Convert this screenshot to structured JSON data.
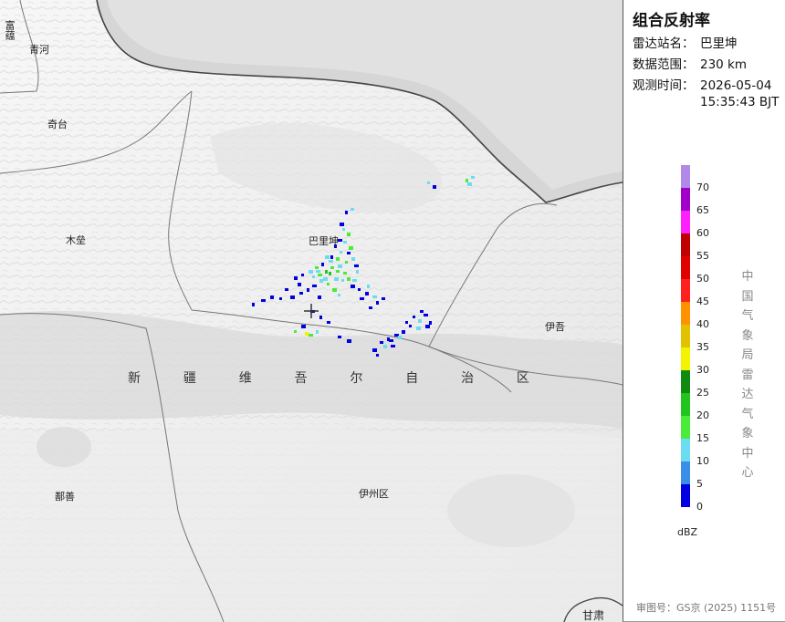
{
  "header": {
    "title": "组合反射率",
    "station_key": "雷达站名：",
    "station_value": "巴里坤",
    "range_key": "数据范围：",
    "range_value": "230 km",
    "time_key": "观测时间：",
    "time_date": "2026-05-04",
    "time_clock": "15:35:43 BJT"
  },
  "map": {
    "places": {
      "fuyun": "富蕴",
      "qinghe": "青河",
      "qitai": "奇台",
      "mulei": "木垒",
      "balikun": "巴里坤",
      "yiwu": "伊吾",
      "shanshan": "鄯善",
      "yizhou": "伊州区",
      "gansu": "甘肃"
    },
    "region_chars": [
      "新",
      "疆",
      "维",
      "吾",
      "尔",
      "自",
      "治",
      "区"
    ],
    "colors": {
      "land": "#f1f1f1",
      "foreign": "#d8d8d8",
      "border": "#555555",
      "marker": "#333333"
    },
    "echo_points": [
      [
        378,
        231,
        "b"
      ],
      [
        384,
        228,
        "c"
      ],
      [
        372,
        244,
        "b"
      ],
      [
        375,
        250,
        "c"
      ],
      [
        380,
        255,
        "g"
      ],
      [
        370,
        262,
        "b"
      ],
      [
        366,
        268,
        "b"
      ],
      [
        376,
        264,
        "c"
      ],
      [
        382,
        270,
        "g"
      ],
      [
        372,
        275,
        "c"
      ],
      [
        368,
        282,
        "g"
      ],
      [
        360,
        285,
        "c"
      ],
      [
        352,
        288,
        "b"
      ],
      [
        345,
        292,
        "g"
      ],
      [
        338,
        296,
        "c"
      ],
      [
        330,
        300,
        "b"
      ],
      [
        322,
        303,
        "b"
      ],
      [
        348,
        300,
        "g"
      ],
      [
        356,
        296,
        "G"
      ],
      [
        362,
        292,
        "g"
      ],
      [
        370,
        290,
        "c"
      ],
      [
        378,
        286,
        "g"
      ],
      [
        385,
        282,
        "c"
      ],
      [
        388,
        290,
        "b"
      ],
      [
        390,
        296,
        "c"
      ],
      [
        376,
        298,
        "g"
      ],
      [
        366,
        304,
        "c"
      ],
      [
        358,
        310,
        "g"
      ],
      [
        350,
        306,
        "c"
      ],
      [
        342,
        312,
        "b"
      ],
      [
        336,
        316,
        "b"
      ],
      [
        328,
        320,
        "b"
      ],
      [
        318,
        324,
        "b"
      ],
      [
        306,
        326,
        "b"
      ],
      [
        296,
        324,
        "b"
      ],
      [
        286,
        328,
        "b"
      ],
      [
        276,
        332,
        "b"
      ],
      [
        312,
        316,
        "b"
      ],
      [
        384,
        312,
        "b"
      ],
      [
        392,
        316,
        "b"
      ],
      [
        400,
        320,
        "b"
      ],
      [
        408,
        324,
        "c"
      ],
      [
        412,
        330,
        "b"
      ],
      [
        404,
        336,
        "b"
      ],
      [
        364,
        316,
        "g"
      ],
      [
        370,
        322,
        "c"
      ],
      [
        348,
        324,
        "b"
      ],
      [
        340,
        340,
        "b"
      ],
      [
        350,
        346,
        "b"
      ],
      [
        358,
        352,
        "b"
      ],
      [
        330,
        356,
        "b"
      ],
      [
        322,
        362,
        "g"
      ],
      [
        334,
        364,
        "y"
      ],
      [
        338,
        366,
        "g"
      ],
      [
        346,
        362,
        "c"
      ],
      [
        370,
        368,
        "b"
      ],
      [
        380,
        372,
        "b"
      ],
      [
        452,
        346,
        "b"
      ],
      [
        458,
        350,
        "c"
      ],
      [
        464,
        344,
        "b"
      ],
      [
        470,
        352,
        "b"
      ],
      [
        460,
        340,
        "b"
      ],
      [
        466,
        356,
        "b"
      ],
      [
        448,
        356,
        "b"
      ],
      [
        440,
        362,
        "b"
      ],
      [
        432,
        366,
        "b"
      ],
      [
        424,
        370,
        "b"
      ],
      [
        416,
        374,
        "b"
      ],
      [
        408,
        382,
        "b"
      ],
      [
        412,
        388,
        "b"
      ],
      [
        420,
        378,
        "c"
      ],
      [
        426,
        372,
        "b"
      ],
      [
        510,
        196,
        "g"
      ],
      [
        516,
        193,
        "c"
      ],
      [
        512,
        200,
        "c"
      ],
      [
        468,
        199,
        "c"
      ],
      [
        474,
        203,
        "b"
      ],
      [
        346,
        296,
        "c"
      ],
      [
        360,
        298,
        "G"
      ],
      [
        368,
        296,
        "g"
      ],
      [
        354,
        304,
        "c"
      ],
      [
        374,
        306,
        "c"
      ],
      [
        380,
        304,
        "g"
      ],
      [
        386,
        306,
        "c"
      ],
      [
        362,
        280,
        "b"
      ],
      [
        380,
        276,
        "b"
      ],
      [
        356,
        280,
        "c"
      ],
      [
        342,
        302,
        "c"
      ],
      [
        326,
        310,
        "b"
      ],
      [
        394,
        326,
        "b"
      ],
      [
        402,
        312,
        "c"
      ],
      [
        418,
        326,
        "b"
      ],
      [
        456,
        358,
        "c"
      ],
      [
        444,
        352,
        "b"
      ],
      [
        436,
        368,
        "c"
      ],
      [
        428,
        378,
        "b"
      ]
    ]
  },
  "legend": {
    "colors": [
      "#0000e0",
      "#3a8ee8",
      "#6cdcf0",
      "#4aeb3a",
      "#22c41e",
      "#108a10",
      "#f4f400",
      "#e2c200",
      "#ff9200",
      "#ff2020",
      "#e00000",
      "#c00000",
      "#ff20ff",
      "#a000c8",
      "#b08ae6"
    ],
    "labels": [
      "0",
      "5",
      "10",
      "15",
      "20",
      "25",
      "30",
      "35",
      "40",
      "45",
      "50",
      "55",
      "60",
      "65",
      "70"
    ],
    "unit": "dBZ",
    "source": "中国气象局雷达气象中心"
  },
  "footer": {
    "approval": "审图号：GS京 (2025) 1151号"
  }
}
